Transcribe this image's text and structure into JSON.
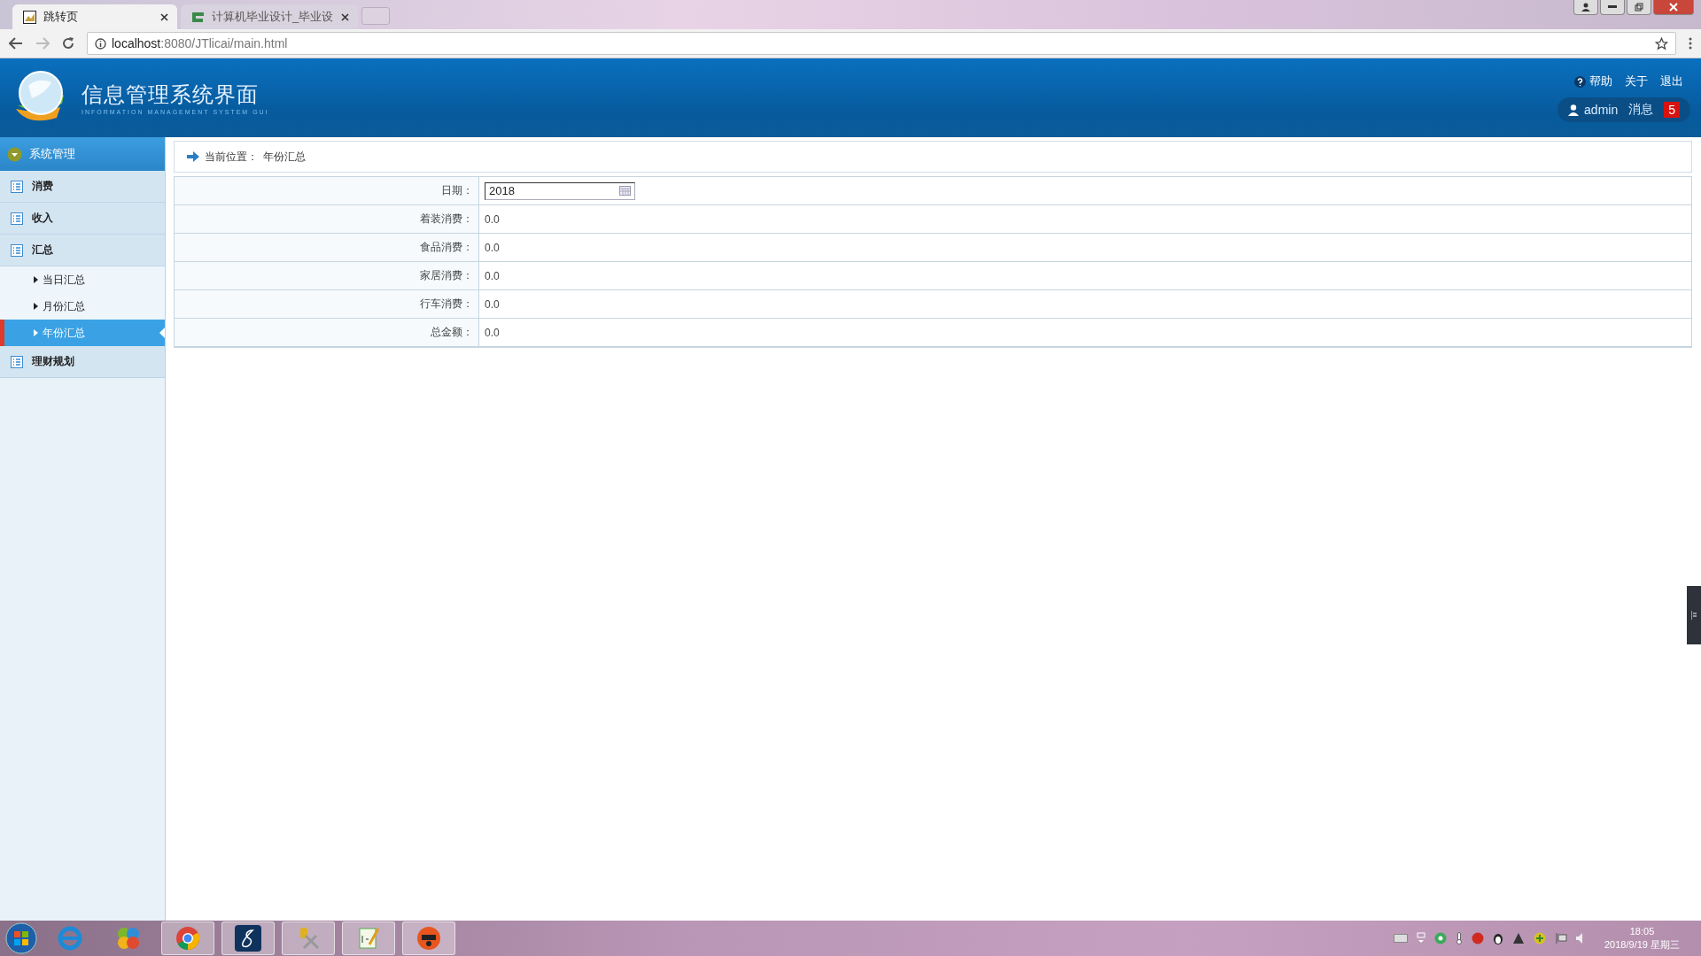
{
  "browser": {
    "tabs": [
      {
        "title": "跳转页",
        "selected": true
      },
      {
        "title": "计算机毕业设计_毕业设",
        "selected": false
      }
    ],
    "url_host": "localhost",
    "url_path": ":8080/JTlicai/main.html"
  },
  "header": {
    "title": "信息管理系统界面",
    "subtitle": "INFORMATION MANAGEMENT SYSTEM GUI",
    "links": [
      "帮助",
      "关于",
      "退出"
    ],
    "user": "admin",
    "messages_label": "消息",
    "message_count": "5"
  },
  "sidebar": {
    "title": "系统管理",
    "items": [
      {
        "label": "消费"
      },
      {
        "label": "收入"
      },
      {
        "label": "汇总",
        "children": [
          {
            "label": "当日汇总",
            "selected": false
          },
          {
            "label": "月份汇总",
            "selected": false
          },
          {
            "label": "年份汇总",
            "selected": true
          }
        ]
      },
      {
        "label": "理财规划"
      }
    ]
  },
  "breadcrumb": {
    "label": "当前位置：",
    "current": "年份汇总"
  },
  "form": {
    "date_label": "日期：",
    "date_value": "2018",
    "rows": [
      {
        "label": "着装消费：",
        "value": "0.0"
      },
      {
        "label": "食品消费：",
        "value": "0.0"
      },
      {
        "label": "家居消费：",
        "value": "0.0"
      },
      {
        "label": "行车消费：",
        "value": "0.0"
      },
      {
        "label": "总金额：",
        "value": "0.0"
      }
    ]
  },
  "taskbar": {
    "time": "18:05",
    "date": "2018/9/19 星期三"
  }
}
